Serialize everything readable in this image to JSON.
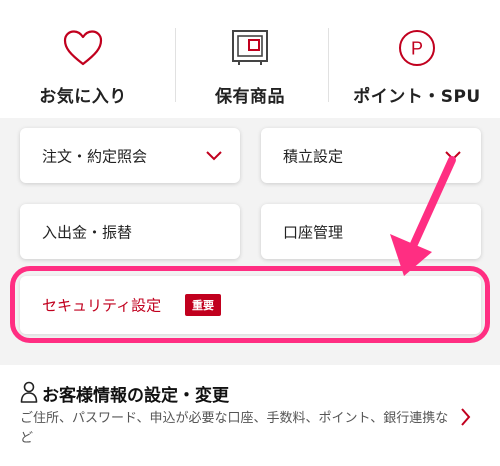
{
  "quick_links": [
    {
      "label": "お気に入り",
      "icon": "heart-icon"
    },
    {
      "label": "保有商品",
      "icon": "holdings-icon"
    },
    {
      "label": "ポイント・SPU",
      "icon": "point-icon",
      "icon_text": "P"
    }
  ],
  "menu": {
    "order_inquiry": "注文・約定照会",
    "accumulation": "積立設定",
    "deposit_transfer": "入出金・振替",
    "account_management": "口座管理"
  },
  "security": {
    "label": "セキュリティ設定",
    "badge": "重要"
  },
  "customer_info": {
    "title": "お客様情報の設定・変更",
    "description": "ご住所、パスワード、申込が必要な口座、手数料、ポイント、銀行連携など"
  },
  "colors": {
    "brand_red": "#c1001e",
    "highlight_pink": "#ff2e82"
  }
}
